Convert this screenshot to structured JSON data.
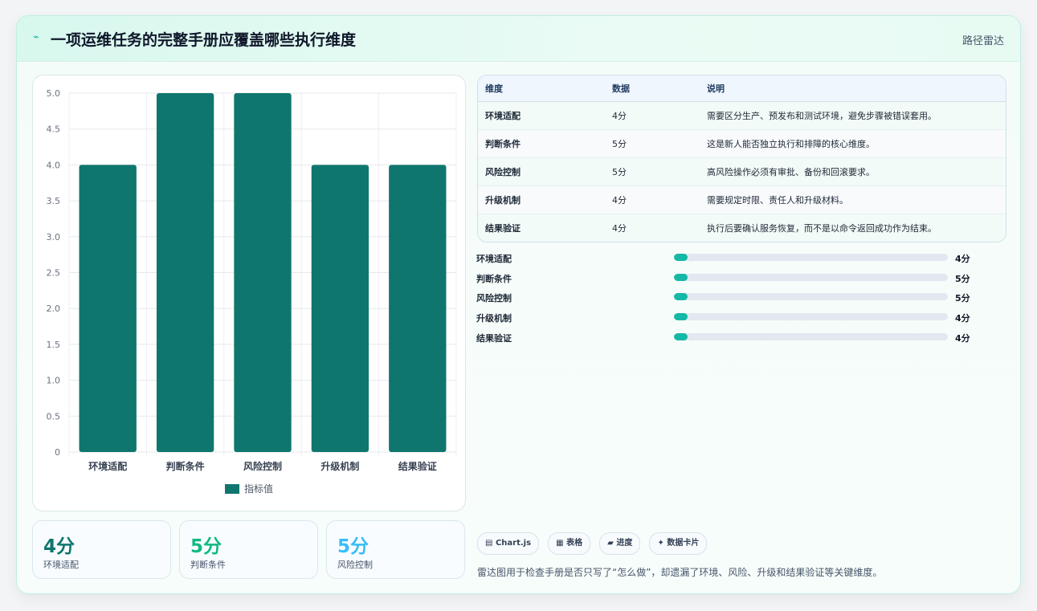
{
  "header": {
    "icon": "lightning-icon",
    "icon_glyph": "⌁",
    "title": "一项运维任务的完整手册应覆盖哪些执行维度",
    "link": "路径雷达"
  },
  "chart_data": {
    "type": "bar",
    "categories": [
      "环境适配",
      "判断条件",
      "风险控制",
      "升级机制",
      "结果验证"
    ],
    "series": [
      {
        "name": "指标值",
        "values": [
          4,
          5,
          5,
          4,
          4
        ],
        "color": "#0f766e"
      }
    ],
    "ylim": [
      0,
      5
    ],
    "yticks": [
      "5.0",
      "4.5",
      "4.0",
      "3.5",
      "3.0",
      "2.5",
      "2.0",
      "1.5",
      "1.0",
      "0.5",
      "0"
    ],
    "grid": true,
    "legend": "bottom",
    "title": "",
    "xlabel": "",
    "ylabel": ""
  },
  "kpis": [
    {
      "value": "4分",
      "label": "环境适配",
      "color": "#0f766e"
    },
    {
      "value": "5分",
      "label": "判断条件",
      "color": "#10b981"
    },
    {
      "value": "5分",
      "label": "风险控制",
      "color": "#38bdf8"
    }
  ],
  "table": {
    "headers": [
      "维度",
      "数据",
      "说明"
    ],
    "rows": [
      [
        "环境适配",
        "4分",
        "需要区分生产、预发布和测试环境，避免步骤被错误套用。"
      ],
      [
        "判断条件",
        "5分",
        "这是新人能否独立执行和排障的核心维度。"
      ],
      [
        "风险控制",
        "5分",
        "高风险操作必须有审批、备份和回滚要求。"
      ],
      [
        "升级机制",
        "4分",
        "需要规定时限、责任人和升级材料。"
      ],
      [
        "结果验证",
        "4分",
        "执行后要确认服务恢复，而不是以命令返回成功作为结束。"
      ]
    ]
  },
  "progress": [
    {
      "label": "环境适配",
      "value": "4分",
      "fraction": 0.05
    },
    {
      "label": "判断条件",
      "value": "5分",
      "fraction": 0.05
    },
    {
      "label": "风险控制",
      "value": "5分",
      "fraction": 0.05
    },
    {
      "label": "升级机制",
      "value": "4分",
      "fraction": 0.05
    },
    {
      "label": "结果验证",
      "value": "4分",
      "fraction": 0.05
    }
  ],
  "chips": [
    {
      "icon": "chart-icon",
      "glyph": "▤",
      "label": "Chart.js"
    },
    {
      "icon": "table-icon",
      "glyph": "▦",
      "label": "表格"
    },
    {
      "icon": "progress-icon",
      "glyph": "▰",
      "label": "进度"
    },
    {
      "icon": "sparkle-icon",
      "glyph": "✦",
      "label": "数据卡片"
    }
  ],
  "footnote": "雷达图用于检查手册是否只写了“怎么做”，却遗漏了环境、风险、升级和结果验证等关键维度。"
}
